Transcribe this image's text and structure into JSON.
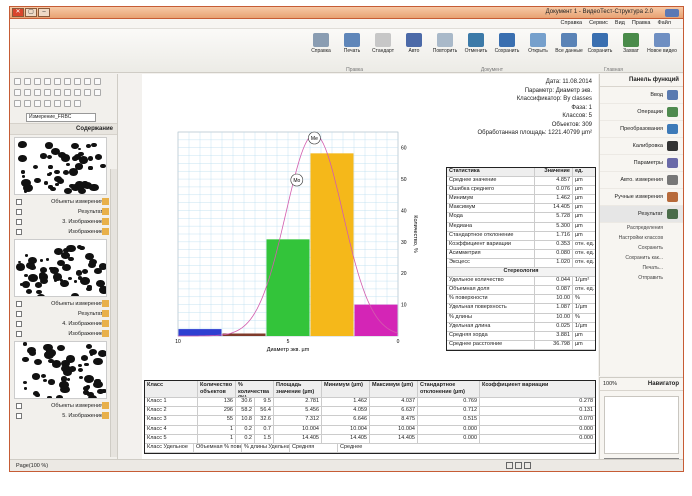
{
  "window": {
    "title": "Документ 1 - ВидеоТест-Структура 2.0",
    "buttons": [
      "✕",
      "▢",
      "–"
    ]
  },
  "menu": [
    "Файл",
    "Правка",
    "Вид",
    "Сервис",
    "Справка"
  ],
  "toolbar": {
    "buttons": [
      {
        "label": "Новое видео",
        "icon": "video-icon",
        "color": "#6f8fc2"
      },
      {
        "label": "Захват",
        "icon": "capture-icon",
        "color": "#4a8b4a"
      },
      {
        "label": "Сохранить",
        "icon": "save-icon",
        "color": "#3a6fb0"
      },
      {
        "label": "Все данные",
        "icon": "all-data-icon",
        "color": "#5a83b6"
      },
      {
        "label": "Открыть",
        "icon": "open-icon",
        "color": "#76a0cc"
      },
      {
        "label": "Сохранить",
        "icon": "save2-icon",
        "color": "#3a6fb0"
      },
      {
        "label": "Отменить",
        "icon": "undo-icon",
        "color": "#3c7aa8"
      },
      {
        "label": "Повторить",
        "icon": "redo-icon",
        "color": "#a9b9c9"
      },
      {
        "label": "Авто",
        "icon": "text-icon",
        "color": "#4c6aa8"
      },
      {
        "label": "Стандарт",
        "icon": "standard-icon",
        "color": "#c7c7c7"
      },
      {
        "label": "Печать",
        "icon": "print-icon",
        "color": "#5f86b9"
      },
      {
        "label": "Справка",
        "icon": "help-icon",
        "color": "#8a9db2"
      }
    ],
    "groups": [
      "Главная",
      "Документ",
      "Правка"
    ]
  },
  "functions_panel": {
    "title": "Панель функций",
    "items": [
      {
        "label": "Ввод",
        "icon": "input-icon",
        "color": "#5a7ab0"
      },
      {
        "label": "Операции",
        "icon": "operations-icon",
        "color": "#4f8a4f"
      },
      {
        "label": "Преобразования",
        "icon": "transform-icon",
        "color": "#3d7ab8"
      },
      {
        "label": "Калибровка",
        "icon": "calibration-icon",
        "color": "#333333"
      },
      {
        "label": "Параметры",
        "icon": "parameters-icon",
        "color": "#6a6aa8"
      },
      {
        "label": "Авто. измерения",
        "icon": "auto-measure-icon",
        "color": "#777777"
      },
      {
        "label": "Ручные измерения",
        "icon": "manual-measure-icon",
        "color": "#b76a3a"
      },
      {
        "label": "Результат",
        "icon": "result-icon",
        "color": "#4a6c4a"
      }
    ],
    "sub_items": [
      "Распределения",
      "Настройки классов",
      "Сохранить",
      "Сохранить как...",
      "Печать...",
      "Отправить"
    ]
  },
  "navigator": {
    "title": "Навигатор",
    "zoom": "100%"
  },
  "content_panel": {
    "title": "Содержание",
    "combo": "Измерение_FRBC",
    "tree": [
      {
        "label": "Объекты измерения"
      },
      {
        "label": "Результат"
      },
      {
        "label": "3. Изображение"
      },
      {
        "label": "Изображение"
      },
      {
        "label": "Объекты измерения"
      },
      {
        "label": "Результат"
      },
      {
        "label": "4. Изображение"
      },
      {
        "label": "Изображение"
      },
      {
        "label": "Объекты измерения"
      },
      {
        "label": "5. Изображение"
      }
    ]
  },
  "document": {
    "header": [
      "Дата: 11.08.2014",
      "Параметр: Диаметр экв.",
      "Классификатор: By classes",
      "Фаза: 1",
      "Классов: 5",
      "Объектов: 309",
      "Обработанная площадь: 1221.40799 µm²"
    ],
    "stats_headers": [
      "Статистика",
      "Значение",
      "ед."
    ],
    "stats": [
      [
        "Среднее значение",
        "4.857",
        "µm"
      ],
      [
        "Ошибка среднего",
        "0.076",
        "µm"
      ],
      [
        "Минимум",
        "1.462",
        "µm"
      ],
      [
        "Максимум",
        "14.405",
        "µm"
      ],
      [
        "Мода",
        "5.728",
        "µm"
      ],
      [
        "Медиана",
        "5.300",
        "µm"
      ],
      [
        "Стандартное отклонение",
        "1.716",
        "µm"
      ],
      [
        "Коэффициент вариации",
        "0.353",
        "отн. ед."
      ],
      [
        "Асимметрия",
        "0.080",
        "отн. ед."
      ],
      [
        "Эксцесс",
        "1.020",
        "отн. ед."
      ]
    ],
    "struct_title": "Стереология",
    "struct": [
      [
        "Удельное количество",
        "0.044",
        "1/µm²"
      ],
      [
        "Объемная доля",
        "0.087",
        "отн. ед."
      ],
      [
        "% поверхности",
        "10.00",
        "%"
      ],
      [
        "Удельная поверхность",
        "1.087",
        "1/µm"
      ],
      [
        "% длины",
        "10.00",
        "%"
      ],
      [
        "Удельная длина",
        "0.025",
        "1/µm"
      ],
      [
        "Средняя хорда",
        "3.881",
        "µm"
      ],
      [
        "Среднее расстояние",
        "36.798",
        "µm"
      ]
    ],
    "classes_headers": [
      "Класс",
      "Количество объектов",
      "% количества (%)",
      "Площадь значение (µm)",
      "Минимум (µm)",
      "Максимум (µm)",
      "Стандартное отклонение (µm)",
      "Коэффициент вариации"
    ],
    "classes": [
      [
        "Класс 1",
        "136",
        "30.6",
        "9.5",
        "2.781",
        "1.462",
        "4.037",
        "0.769",
        "0.278"
      ],
      [
        "Класс 2",
        "296",
        "58.2",
        "56.4",
        "5.456",
        "4.059",
        "6.637",
        "0.712",
        "0.131"
      ],
      [
        "Класс 3",
        "55",
        "10.8",
        "32.6",
        "7.312",
        "6.646",
        "8.475",
        "0.515",
        "0.070"
      ],
      [
        "Класс 4",
        "1",
        "0.2",
        "0.7",
        "10.004",
        "10.004",
        "10.004",
        "0.000",
        "0.000"
      ],
      [
        "Класс 5",
        "1",
        "0.2",
        "1.5",
        "14.405",
        "14.405",
        "14.405",
        "0.000",
        "0.000"
      ]
    ],
    "classes_footer": [
      "Класс Удельное",
      "Объемная % поверхности Удельная",
      "% длины Удельная",
      "Средняя",
      "Среднее"
    ]
  },
  "chart_data": {
    "type": "bar",
    "xlabel": "Диаметр экв. µm",
    "ylabel": "Количество, %",
    "categories": [
      "Класс 1",
      "Класс 2",
      "Класс 3",
      "Класс 4",
      "Класс 5"
    ],
    "values": [
      2.2,
      1.0,
      30.8,
      58.2,
      10.0
    ],
    "colors": [
      "#2f3fd1",
      "#7f3a2a",
      "#33c43a",
      "#f5b81a",
      "#d425b6"
    ],
    "x_ticks": [
      "0",
      "5",
      "10"
    ],
    "y_ticks": [
      "10",
      "20",
      "30",
      "40",
      "50",
      "60"
    ],
    "ylim": [
      0,
      65
    ],
    "markers": [
      "Mo",
      "Me"
    ],
    "grid": true
  },
  "status": {
    "zoom": "Page(100 %)"
  }
}
